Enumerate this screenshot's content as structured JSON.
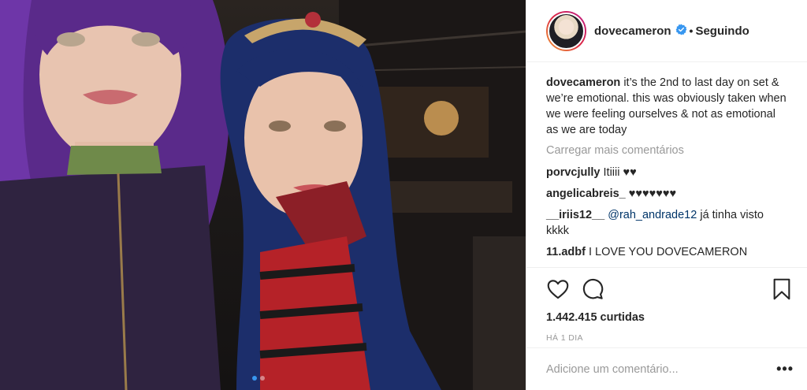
{
  "header": {
    "username": "dovecameron",
    "separator": "•",
    "follow_status": "Seguindo"
  },
  "caption": {
    "username": "dovecameron",
    "text": "it’s the 2nd to last day on set & we’re emotional. this was obviously taken when we were feeling ourselves & not as emotional as we are today"
  },
  "load_more": "Carregar mais comentários",
  "comments": [
    {
      "username": "porvcjully",
      "text": "Itiiii ♥♥"
    },
    {
      "username": "angelicabreis_",
      "text": "♥♥♥♥♥♥♥"
    },
    {
      "username": "__iriis12__",
      "mention": "@rah_andrade12",
      "text": "já tinha visto kkkk"
    },
    {
      "username": "11.adbf",
      "text": "I LOVE YOU DOVECAMERON"
    }
  ],
  "likes": "1.442.415 curtidas",
  "time": "HÁ 1 DIA",
  "add_comment": {
    "placeholder": "Adicione um comentário..."
  },
  "more_options": "•••",
  "icons": {
    "like": "heart-icon",
    "comment": "comment-bubble-icon",
    "save": "bookmark-icon",
    "verified": "verified-badge-icon"
  },
  "colors": {
    "verified": "#3897f0",
    "text": "#262626",
    "muted": "#999999",
    "mention": "#003569",
    "border": "#efefef"
  },
  "carousel": {
    "count": 2,
    "active": 1
  }
}
